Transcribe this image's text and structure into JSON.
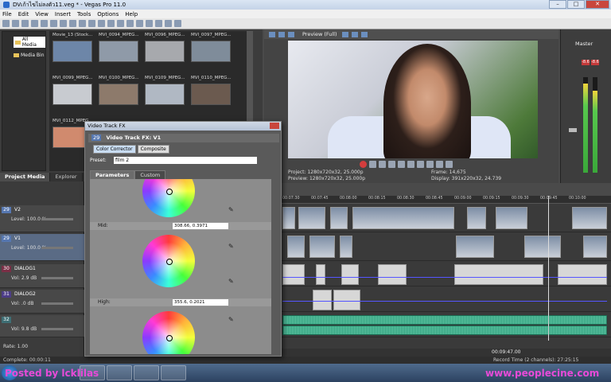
{
  "window": {
    "title": "DVเก้าไขไม่ลงตัว11.veg * - Vegas Pro 11.0",
    "min": "–",
    "max": "□",
    "close": "✕"
  },
  "menu": [
    "File",
    "Edit",
    "View",
    "Insert",
    "Tools",
    "Options",
    "Help"
  ],
  "explorer": {
    "tree": [
      {
        "label": "All Media",
        "selected": true
      },
      {
        "label": "Media Bin",
        "selected": false
      }
    ],
    "thumbs": [
      {
        "label": "Movie_13 (Stock...",
        "color": "#6d86a8"
      },
      {
        "label": "MVI_0094_MPEG...",
        "color": "#8f9aa8"
      },
      {
        "label": "MVI_0096_MPEG...",
        "color": "#a7a9ad"
      },
      {
        "label": "MVI_0097_MPEG...",
        "color": "#7f8c9a"
      },
      {
        "label": "MVI_0099_MPEG...",
        "color": "#c8cbd0"
      },
      {
        "label": "MVI_0100_MPEG...",
        "color": "#8d7a6b"
      },
      {
        "label": "MVI_0109_MPEG...",
        "color": "#b0b8c3"
      },
      {
        "label": "MVI_0110_MPEG...",
        "color": "#6b5a4f"
      },
      {
        "label": "MVI_0112_MPEG...",
        "color": "#d08a6e"
      }
    ],
    "tabs": [
      {
        "label": "Project Media",
        "active": true
      },
      {
        "label": "Explorer",
        "active": false
      },
      {
        "label": "Tr",
        "active": false
      }
    ]
  },
  "preview": {
    "mode": "Preview (Full)",
    "project_label": "Project:",
    "project": "1280x720x32, 25.000p",
    "preview_label": "Preview:",
    "preview_val": "1280x720x32, 25.000p",
    "frame_label": "Frame:",
    "frame": "14,675",
    "display_label": "Display:",
    "display": "391x220x32, 24.739"
  },
  "master": {
    "label": "Master",
    "peak_l": "-8.6",
    "peak_r": "-8.6",
    "level_l": 0.93,
    "level_r": 0.86
  },
  "tracks": [
    {
      "num": "29",
      "name": "V2",
      "level_label": "Level:",
      "level": "100.0 %",
      "kind": "video",
      "selected": false
    },
    {
      "num": "29",
      "name": "V1",
      "level_label": "Level:",
      "level": "100.0 %",
      "kind": "video",
      "selected": true
    },
    {
      "num": "30",
      "name": "DIALOG1",
      "level_label": "Vol:",
      "level": "2.9 dB",
      "kind": "audio",
      "selected": false
    },
    {
      "num": "31",
      "name": "DIALOG2",
      "level_label": "Vol:",
      "level": ".0 dB",
      "kind": "audio2",
      "selected": false
    },
    {
      "num": "32",
      "name": "",
      "level_label": "Vol:",
      "level": "9.8 dB",
      "kind": "audio3",
      "selected": false
    }
  ],
  "rate": "Rate: 1.00",
  "ruler_ticks": [
    "00:07:30",
    "00:07:45",
    "00:08:00",
    "00:08:15",
    "00:08:30",
    "00:08:45",
    "00:09:00",
    "00:09:15",
    "00:09:30",
    "00:09:45",
    "00:10:00"
  ],
  "timecode": "00:09:47.00",
  "status": {
    "complete": "Complete: 00:00:11",
    "record": "Record Time (2 channels): 27:25:15"
  },
  "fx": {
    "title": "Video Track FX",
    "header_num": "29",
    "header": "Video Track FX:  V1",
    "chain": [
      {
        "label": "Color Corrector",
        "on": true
      },
      {
        "label": "Composite",
        "on": false
      }
    ],
    "preset_label": "Preset:",
    "preset": "film 2",
    "tabs": [
      {
        "label": "Parameters",
        "active": true
      },
      {
        "label": "Custom",
        "active": false
      }
    ],
    "sections": [
      {
        "label": "Mid:",
        "value": "308.66, 0.3971"
      },
      {
        "label": "High:",
        "value": "355.6, 0.2021"
      }
    ]
  },
  "watermarks": {
    "left": "Posted by lcklilas",
    "right": "www.peoplecine.com"
  }
}
